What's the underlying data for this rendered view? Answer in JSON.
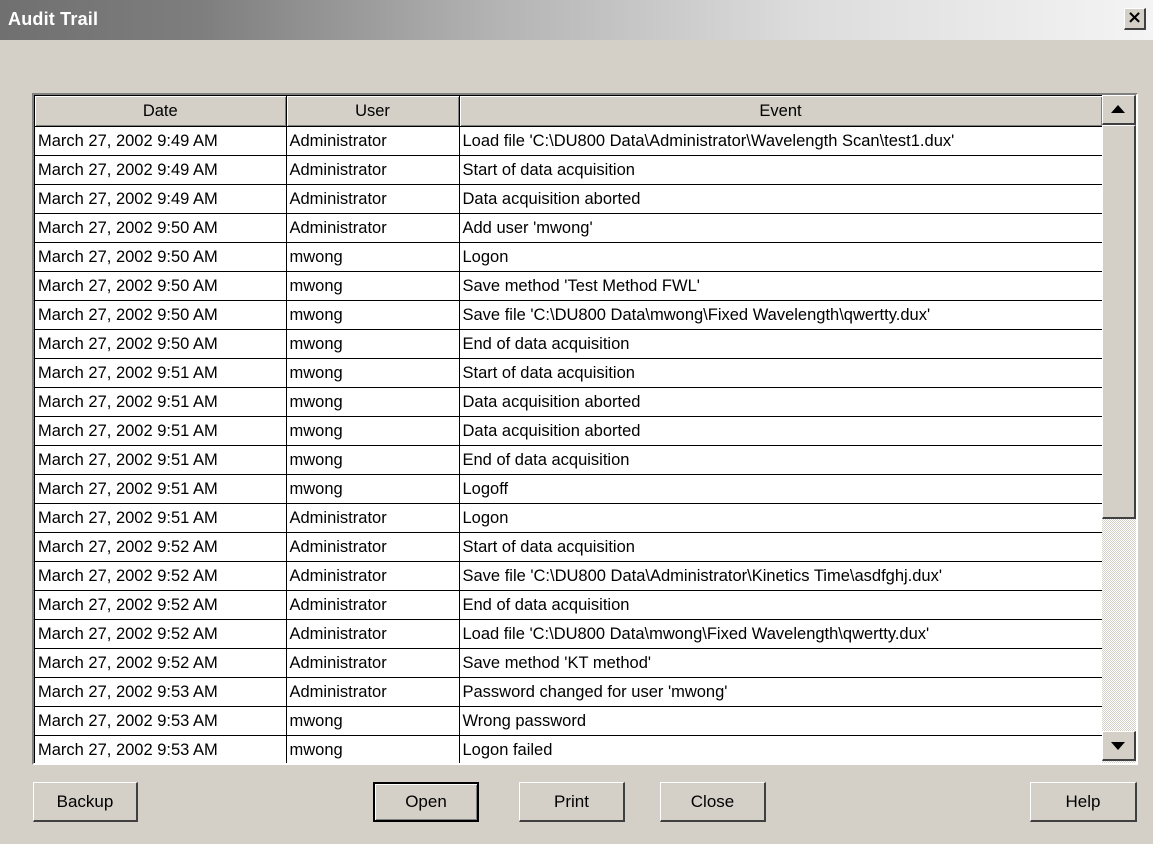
{
  "window": {
    "title": "Audit Trail",
    "close_glyph": "×",
    "close_icon": "close-icon"
  },
  "table": {
    "columns": [
      "Date",
      "User",
      "Event"
    ],
    "rows": [
      {
        "date": "March 27, 2002 9:49 AM",
        "user": "Administrator",
        "event": "Load file 'C:\\DU800 Data\\Administrator\\Wavelength Scan\\test1.dux'"
      },
      {
        "date": "March 27, 2002 9:49 AM",
        "user": "Administrator",
        "event": "Start of data acquisition"
      },
      {
        "date": "March 27, 2002 9:49 AM",
        "user": "Administrator",
        "event": "Data acquisition aborted"
      },
      {
        "date": "March 27, 2002 9:50 AM",
        "user": "Administrator",
        "event": "Add user 'mwong'"
      },
      {
        "date": "March 27, 2002 9:50 AM",
        "user": "mwong",
        "event": "Logon"
      },
      {
        "date": "March 27, 2002 9:50 AM",
        "user": "mwong",
        "event": "Save method 'Test Method FWL'"
      },
      {
        "date": "March 27, 2002 9:50 AM",
        "user": "mwong",
        "event": "Save file 'C:\\DU800 Data\\mwong\\Fixed Wavelength\\qwertty.dux'"
      },
      {
        "date": "March 27, 2002 9:50 AM",
        "user": "mwong",
        "event": "End of data acquisition"
      },
      {
        "date": "March 27, 2002 9:51 AM",
        "user": "mwong",
        "event": "Start of data acquisition"
      },
      {
        "date": "March 27, 2002 9:51 AM",
        "user": "mwong",
        "event": "Data acquisition aborted"
      },
      {
        "date": "March 27, 2002 9:51 AM",
        "user": "mwong",
        "event": "Data acquisition aborted"
      },
      {
        "date": "March 27, 2002 9:51 AM",
        "user": "mwong",
        "event": "End of data acquisition"
      },
      {
        "date": "March 27, 2002 9:51 AM",
        "user": "mwong",
        "event": "Logoff"
      },
      {
        "date": "March 27, 2002 9:51 AM",
        "user": "Administrator",
        "event": "Logon"
      },
      {
        "date": "March 27, 2002 9:52 AM",
        "user": "Administrator",
        "event": "Start of data acquisition"
      },
      {
        "date": "March 27, 2002 9:52 AM",
        "user": "Administrator",
        "event": "Save file 'C:\\DU800 Data\\Administrator\\Kinetics Time\\asdfghj.dux'"
      },
      {
        "date": "March 27, 2002 9:52 AM",
        "user": "Administrator",
        "event": "End of data acquisition"
      },
      {
        "date": "March 27, 2002 9:52 AM",
        "user": "Administrator",
        "event": "Load file 'C:\\DU800 Data\\mwong\\Fixed Wavelength\\qwertty.dux'"
      },
      {
        "date": "March 27, 2002 9:52 AM",
        "user": "Administrator",
        "event": "Save method 'KT method'"
      },
      {
        "date": "March 27, 2002 9:53 AM",
        "user": "Administrator",
        "event": "Password changed for user 'mwong'"
      },
      {
        "date": "March 27, 2002 9:53 AM",
        "user": "mwong",
        "event": "Wrong password"
      },
      {
        "date": "March 27, 2002 9:53 AM",
        "user": "mwong",
        "event": "Logon failed"
      }
    ]
  },
  "scrollbar": {
    "up_icon": "arrow-up-icon",
    "down_icon": "arrow-down-icon"
  },
  "buttons": {
    "backup": "Backup",
    "open": "Open",
    "print": "Print",
    "close": "Close",
    "help": "Help"
  },
  "colors": {
    "dialog_face": "#d4d0c8",
    "grid_background": "#ffffff",
    "title_text": "#ffffff"
  }
}
